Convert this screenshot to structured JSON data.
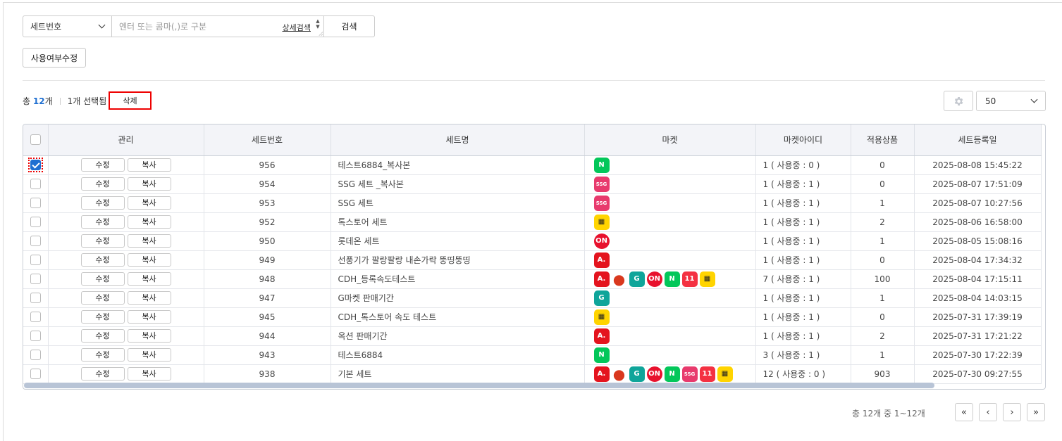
{
  "search": {
    "field_select": "세트번호",
    "placeholder": "엔터 또는 콤마(,)로 구분",
    "advanced_link": "상세검색",
    "search_button": "검색"
  },
  "actions": {
    "usage_edit_button": "사용여부수정",
    "delete_button": "삭제"
  },
  "summary": {
    "total_prefix": "총",
    "total_count": "12",
    "total_suffix": "개",
    "selected_text": "1개 선택됨"
  },
  "page_size": "50",
  "table": {
    "headers": [
      "관리",
      "세트번호",
      "세트명",
      "마켓",
      "마켓아이디",
      "적용상품",
      "세트등록일"
    ],
    "edit_label": "수정",
    "copy_label": "복사",
    "rows": [
      {
        "checked": true,
        "no": "956",
        "name": "테스트6884_복사본",
        "markets": [
          "naver"
        ],
        "account": "1 ( 사용중 : 0 )",
        "products": "0",
        "date": "2025-08-08 15:45:22"
      },
      {
        "checked": false,
        "no": "954",
        "name": "SSG 세트 _복사본",
        "markets": [
          "ssg"
        ],
        "account": "1 ( 사용중 : 1 )",
        "products": "0",
        "date": "2025-08-07 17:51:09"
      },
      {
        "checked": false,
        "no": "953",
        "name": "SSG 세트",
        "markets": [
          "ssg"
        ],
        "account": "1 ( 사용중 : 1 )",
        "products": "1",
        "date": "2025-08-07 10:27:56"
      },
      {
        "checked": false,
        "no": "952",
        "name": "톡스토어 세트",
        "markets": [
          "toss"
        ],
        "account": "1 ( 사용중 : 1 )",
        "products": "2",
        "date": "2025-08-06 16:58:00"
      },
      {
        "checked": false,
        "no": "950",
        "name": "롯데온 세트",
        "markets": [
          "lotteon"
        ],
        "account": "1 ( 사용중 : 1 )",
        "products": "1",
        "date": "2025-08-05 15:08:16"
      },
      {
        "checked": false,
        "no": "949",
        "name": "선풍기가 팔랑팔랑 내손가락 뚱띵뚱띵",
        "markets": [
          "auction"
        ],
        "account": "1 ( 사용중 : 1 )",
        "products": "0",
        "date": "2025-08-04 17:34:32"
      },
      {
        "checked": false,
        "no": "948",
        "name": "CDH_등록속도테스트",
        "markets": [
          "auction",
          "coupang",
          "gmarket",
          "lotteon",
          "naver",
          "11st",
          "toss"
        ],
        "account": "7 ( 사용중 : 1 )",
        "products": "100",
        "date": "2025-08-04 17:15:11"
      },
      {
        "checked": false,
        "no": "947",
        "name": "G마켓 판매기간",
        "markets": [
          "gmarket"
        ],
        "account": "1 ( 사용중 : 1 )",
        "products": "1",
        "date": "2025-08-04 14:03:15"
      },
      {
        "checked": false,
        "no": "945",
        "name": "CDH_톡스토어 속도 테스트",
        "markets": [
          "toss"
        ],
        "account": "1 ( 사용중 : 1 )",
        "products": "0",
        "date": "2025-07-31 17:39:19"
      },
      {
        "checked": false,
        "no": "944",
        "name": "옥션 판매기간",
        "markets": [
          "auction"
        ],
        "account": "1 ( 사용중 : 1 )",
        "products": "2",
        "date": "2025-07-31 17:21:22"
      },
      {
        "checked": false,
        "no": "943",
        "name": "테스트6884",
        "markets": [
          "naver"
        ],
        "account": "3 ( 사용중 : 1 )",
        "products": "1",
        "date": "2025-07-30 17:22:39"
      },
      {
        "checked": false,
        "no": "938",
        "name": "기본 세트",
        "markets": [
          "auction",
          "coupang",
          "gmarket",
          "lotteon",
          "naver",
          "ssg",
          "11st",
          "toss"
        ],
        "account": "12 ( 사용중 : 0 )",
        "products": "903",
        "date": "2025-07-30 09:27:55"
      }
    ]
  },
  "market_icons": {
    "naver": {
      "glyph": "N",
      "bg": "#03c75a",
      "fg": "#ffffff"
    },
    "ssg": {
      "glyph": "SSG",
      "bg": "#e83a6d",
      "fg": "#ffffff"
    },
    "toss": {
      "glyph": "▦",
      "bg": "#ffd400",
      "fg": "#222222"
    },
    "lotteon": {
      "glyph": "ON",
      "bg": "#e8112d",
      "fg": "#ffffff"
    },
    "auction": {
      "glyph": "A.",
      "bg": "#e4141e",
      "fg": "#ffffff"
    },
    "coupang": {
      "glyph": "●",
      "bg": "#ffffff",
      "fg": "#d9381e"
    },
    "gmarket": {
      "glyph": "G",
      "bg": "#0fa59a",
      "fg": "#ffffff"
    },
    "11st": {
      "glyph": "11",
      "bg": "#f43142",
      "fg": "#ffffff"
    }
  },
  "footer": {
    "range_text": "총 12개 중 1~12개",
    "first": "«",
    "prev": "‹",
    "next": "›",
    "last": "»"
  }
}
